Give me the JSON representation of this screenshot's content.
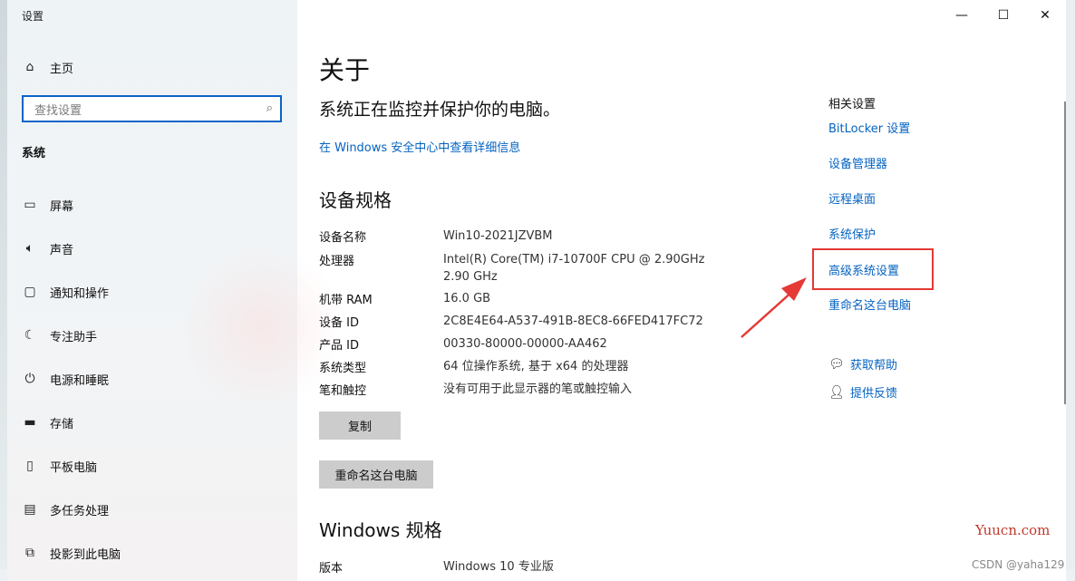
{
  "window": {
    "title": "设置"
  },
  "titlebar": {
    "minimize": "—",
    "maximize": "☐",
    "close": "✕"
  },
  "sidebar": {
    "home_label": "主页",
    "search_placeholder": "查找设置",
    "section": "系统",
    "items": [
      {
        "label": "屏幕",
        "icon": "monitor-icon"
      },
      {
        "label": "声音",
        "icon": "speaker-icon"
      },
      {
        "label": "通知和操作",
        "icon": "notification-icon"
      },
      {
        "label": "专注助手",
        "icon": "moon-icon"
      },
      {
        "label": "电源和睡眠",
        "icon": "power-icon"
      },
      {
        "label": "存储",
        "icon": "storage-icon"
      },
      {
        "label": "平板电脑",
        "icon": "tablet-icon"
      },
      {
        "label": "多任务处理",
        "icon": "multitask-icon"
      },
      {
        "label": "投影到此电脑",
        "icon": "project-icon"
      }
    ]
  },
  "main": {
    "title": "关于",
    "protect_text": "系统正在监控并保护你的电脑。",
    "security_link": "在 Windows 安全中心中查看详细信息",
    "device_spec_title": "设备规格",
    "specs": [
      {
        "key": "设备名称",
        "value": "Win10-2021JZVBM"
      },
      {
        "key": "处理器",
        "value": "Intel(R) Core(TM) i7-10700F CPU @ 2.90GHz   2.90 GHz"
      },
      {
        "key": "机带 RAM",
        "value": "16.0 GB"
      },
      {
        "key": "设备 ID",
        "value": "2C8E4E64-A537-491B-8EC8-66FED417FC72"
      },
      {
        "key": "产品 ID",
        "value": "00330-80000-00000-AA462"
      },
      {
        "key": "系统类型",
        "value": "64 位操作系统, 基于 x64 的处理器"
      },
      {
        "key": "笔和触控",
        "value": "没有可用于此显示器的笔或触控输入"
      }
    ],
    "copy_button": "复制",
    "rename_button": "重命名这台电脑",
    "windows_spec_title": "Windows 规格",
    "edition_key": "版本",
    "edition_value": "Windows 10 专业版"
  },
  "related": {
    "title": "相关设置",
    "links": [
      "BitLocker 设置",
      "设备管理器",
      "远程桌面",
      "系统保护",
      "高级系统设置",
      "重命名这台电脑"
    ],
    "help": "获取帮助",
    "feedback": "提供反馈"
  },
  "annotation": {
    "highlight_color": "#e53935"
  },
  "watermarks": {
    "site": "Yuucn.com",
    "csdn": "CSDN @yaha129"
  },
  "colors": {
    "accent": "#0563c1",
    "search_border": "#0a64c8"
  }
}
